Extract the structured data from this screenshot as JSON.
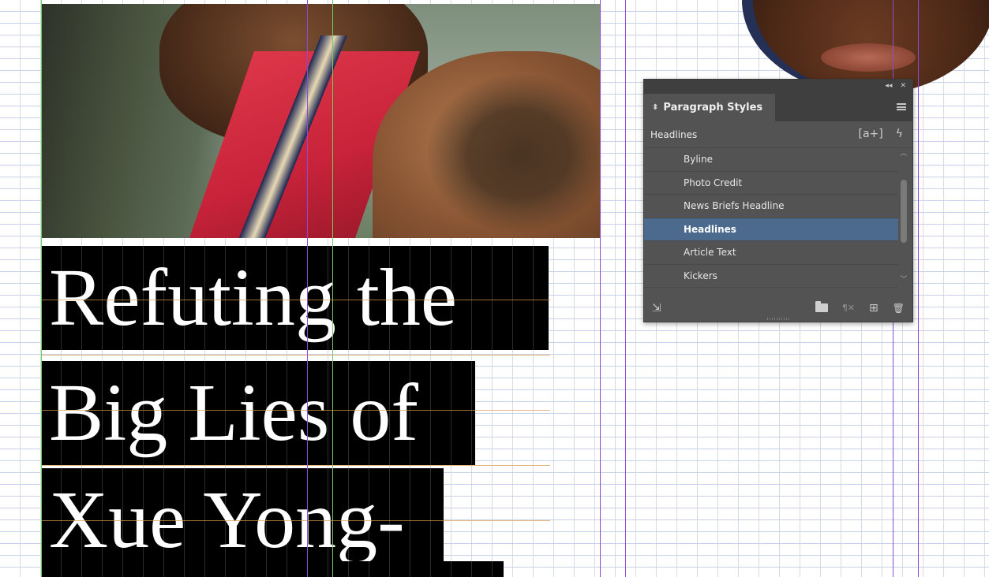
{
  "headline_frame": {
    "lines": [
      "Refuting the",
      "Big Lies of",
      "Xue Yong-"
    ]
  },
  "paragraph_styles_panel": {
    "collapse_glyph": "◂◂",
    "close_glyph": "✕",
    "title": "Paragraph Styles",
    "updown_glyph": "⬍",
    "current_style": "Headlines",
    "new_style_glyph": "[a+]",
    "lightning_glyph": "ϟ",
    "styles": [
      {
        "label": "Byline"
      },
      {
        "label": "Photo Credit"
      },
      {
        "label": "News Briefs Headline"
      },
      {
        "label": "Headlines",
        "selected": true
      },
      {
        "label": "Article Text"
      },
      {
        "label": "Kickers"
      }
    ],
    "bottom_icons": [
      "load-styles-icon",
      "folder-icon",
      "clear-overrides-icon",
      "new-style-icon",
      "trash-icon"
    ],
    "bottom_glyphs": {
      "load": "⇲",
      "clear": "¶✕",
      "new": "⊞",
      "trash": "🗑"
    },
    "selection_color": "#4b6a8e"
  }
}
